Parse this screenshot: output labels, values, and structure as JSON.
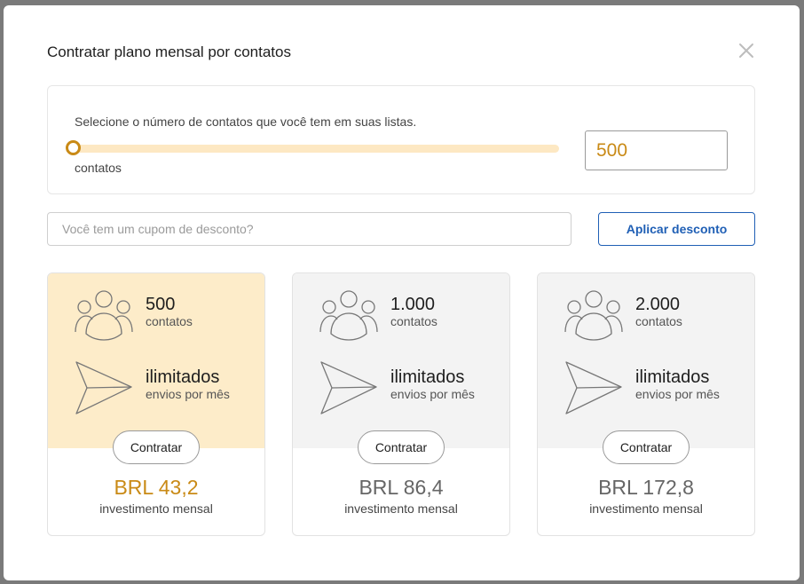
{
  "modal": {
    "title": "Contratar plano mensal por contatos"
  },
  "slider": {
    "label": "Selecione o número de contatos que você tem em suas listas.",
    "unit": "contatos",
    "value_fraction": 0
  },
  "contacts_input": {
    "value": "500"
  },
  "coupon": {
    "placeholder": "Você tem um cupom de desconto?",
    "apply_label": "Aplicar desconto"
  },
  "colors": {
    "accent": "#c98a16",
    "selected_card_bg": "#fdecc9",
    "card_bg": "#f3f3f3",
    "link_blue": "#1f5fb5"
  },
  "plans": [
    {
      "contacts_value": "500",
      "contacts_label": "contatos",
      "sends_value": "ilimitados",
      "sends_label": "envios por mês",
      "button_label": "Contratar",
      "price": "BRL 43,2",
      "price_label": "investimento mensal",
      "selected": true
    },
    {
      "contacts_value": "1.000",
      "contacts_label": "contatos",
      "sends_value": "ilimitados",
      "sends_label": "envios por mês",
      "button_label": "Contratar",
      "price": "BRL 86,4",
      "price_label": "investimento mensal",
      "selected": false
    },
    {
      "contacts_value": "2.000",
      "contacts_label": "contatos",
      "sends_value": "ilimitados",
      "sends_label": "envios por mês",
      "button_label": "Contratar",
      "price": "BRL 172,8",
      "price_label": "investimento mensal",
      "selected": false
    }
  ]
}
